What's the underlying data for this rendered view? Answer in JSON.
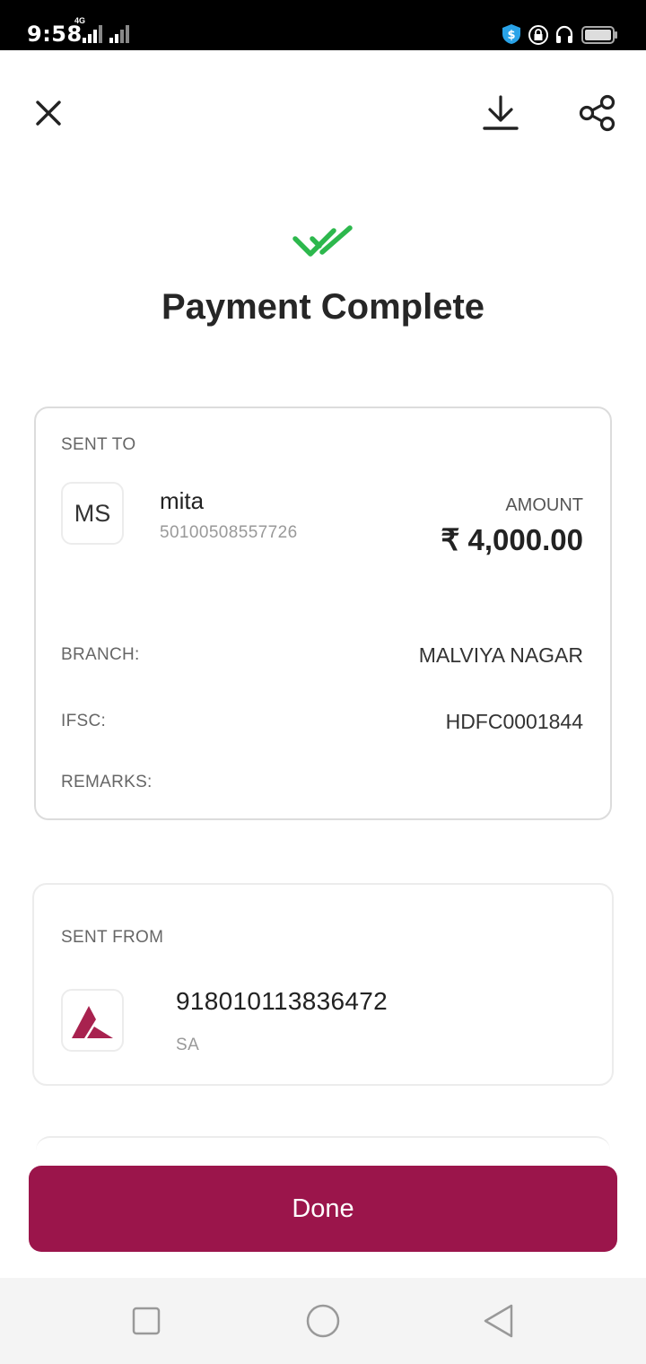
{
  "status_bar": {
    "time": "9:58",
    "network": "4G",
    "icons": [
      "signal-icon",
      "signal-icon",
      "vpn-shield-icon",
      "lock-rotation-icon",
      "headset-icon",
      "battery-icon"
    ]
  },
  "topbar": {
    "icons": [
      "close-icon",
      "download-icon",
      "share-icon"
    ]
  },
  "header": {
    "title": "Payment Complete",
    "icon": "double-check-icon"
  },
  "sent_to": {
    "heading": "SENT TO",
    "avatar_initials": "MS",
    "name": "mita",
    "account": "50100508557726",
    "amount_label": "AMOUNT",
    "amount": "₹ 4,000.00",
    "branch_label": "BRANCH:",
    "branch": "MALVIYA NAGAR",
    "ifsc_label": "IFSC:",
    "ifsc": "HDFC0001844",
    "remarks_label": "REMARKS:",
    "remarks": ""
  },
  "sent_from": {
    "heading": "SENT FROM",
    "bank_logo": "axis-bank-logo",
    "account": "918010113836472",
    "account_type": "SA"
  },
  "actions": {
    "done_label": "Done"
  },
  "navbar": {
    "icons": [
      "recents-square-icon",
      "home-circle-icon",
      "back-triangle-icon"
    ]
  },
  "colors": {
    "brand": "#9b154b",
    "success": "#2db84d"
  }
}
